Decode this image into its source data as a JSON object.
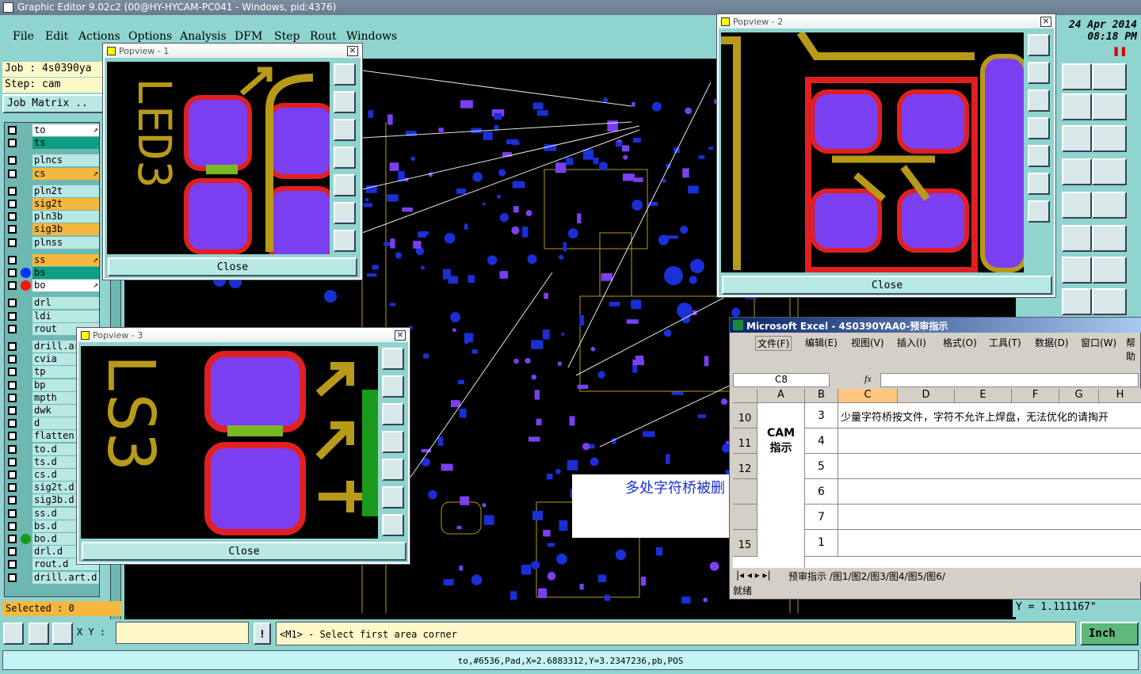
{
  "app": {
    "title": "Graphic Editor 9.02c2 (00@HY-HYCAM-PC041 - Windows, pid:4376)"
  },
  "menu": [
    "File",
    "Edit",
    "Actions",
    "Options",
    "Analysis",
    "DFM",
    "Step",
    "Rout",
    "Windows"
  ],
  "clock": {
    "date": "24 Apr 2014",
    "time": "08:18 PM"
  },
  "job": {
    "job_label": "Job : 4s0390ya",
    "step_label": "Step: cam",
    "matrix_button": "Job Matrix .."
  },
  "layers": [
    {
      "name": "to",
      "state": "white",
      "flag": "↗"
    },
    {
      "name": "ts",
      "state": "teal"
    },
    {
      "name": "plncs"
    },
    {
      "name": "cs",
      "state": "orange",
      "flag": "↗"
    },
    {
      "name": "pln2t"
    },
    {
      "name": "sig2t",
      "state": "orange"
    },
    {
      "name": "pln3b"
    },
    {
      "name": "sig3b",
      "state": "orange"
    },
    {
      "name": "plnss"
    },
    {
      "name": "ss",
      "state": "orange",
      "flag": "↗"
    },
    {
      "name": "bs",
      "state": "teal",
      "dot": "#0033ff"
    },
    {
      "name": "bo",
      "state": "white",
      "dot": "#ff1111",
      "flag": "↗"
    },
    {
      "name": "drl"
    },
    {
      "name": "ldi"
    },
    {
      "name": "rout"
    },
    {
      "name": "drill.art"
    },
    {
      "name": "cvia"
    },
    {
      "name": "tp"
    },
    {
      "name": "bp"
    },
    {
      "name": "mpth"
    },
    {
      "name": "dwk"
    },
    {
      "name": "d"
    },
    {
      "name": "flatten"
    },
    {
      "name": "to.d"
    },
    {
      "name": "ts.d"
    },
    {
      "name": "cs.d"
    },
    {
      "name": "sig2t.d"
    },
    {
      "name": "sig3b.d"
    },
    {
      "name": "ss.d"
    },
    {
      "name": "bs.d"
    },
    {
      "name": "bo.d",
      "dot": "#1a9a1a"
    },
    {
      "name": "drl.d"
    },
    {
      "name": "rout.d"
    },
    {
      "name": "drill.art.d"
    }
  ],
  "selected": "Selected : 0",
  "popups": {
    "p1": {
      "title": "Popview - 1",
      "close": "Close",
      "text": "LED3"
    },
    "p2": {
      "title": "Popview - 2",
      "close": "Close"
    },
    "p3": {
      "title": "Popview - 3",
      "close": "Close",
      "text": "LS3"
    }
  },
  "overlay_note": "多处字符桥被删",
  "excel": {
    "title": "Microsoft Excel - 4S0390YAA0-预审指示",
    "menu": [
      "文件(F)",
      "编辑(E)",
      "视图(V)",
      "插入(I)",
      "格式(O)",
      "工具(T)",
      "数据(D)",
      "窗口(W)",
      "帮助"
    ],
    "namebox": "C8",
    "fx": "fx",
    "columns": [
      "A",
      "B",
      "C",
      "D",
      "E",
      "F",
      "G",
      "H"
    ],
    "rows": [
      {
        "row": "10",
        "num": "3",
        "text": "少量字符桥按文件，字符不允许上焊盘，无法优化的请掏开"
      },
      {
        "row": "11",
        "num": "4",
        "text": ""
      },
      {
        "row": "12",
        "num": "5",
        "text": ""
      },
      {
        "row": "",
        "num": "6",
        "text": ""
      },
      {
        "row": "",
        "num": "7",
        "text": ""
      },
      {
        "row": "15",
        "num": "1",
        "text": ""
      }
    ],
    "a_label": "CAM\n指示",
    "sheets": "预审指示 /图1/图2/图3/图4/图5/图6/",
    "status": "就绪"
  },
  "ycoord": "Y = 1.111167\"",
  "xy_label": "X Y :",
  "xy_value": "",
  "prompt": "<M1> - Select first area corner",
  "units": "Inch",
  "statusbar": "to,#6536,Pad,X=2.6883312,Y=3.2347236,pb,POS",
  "colors": {
    "violet": "#7b3ff2",
    "red": "#e02020",
    "olive": "#b89a18",
    "blue": "#1a2fd6",
    "green": "#7ab822",
    "bg": "#8fd4cf"
  }
}
